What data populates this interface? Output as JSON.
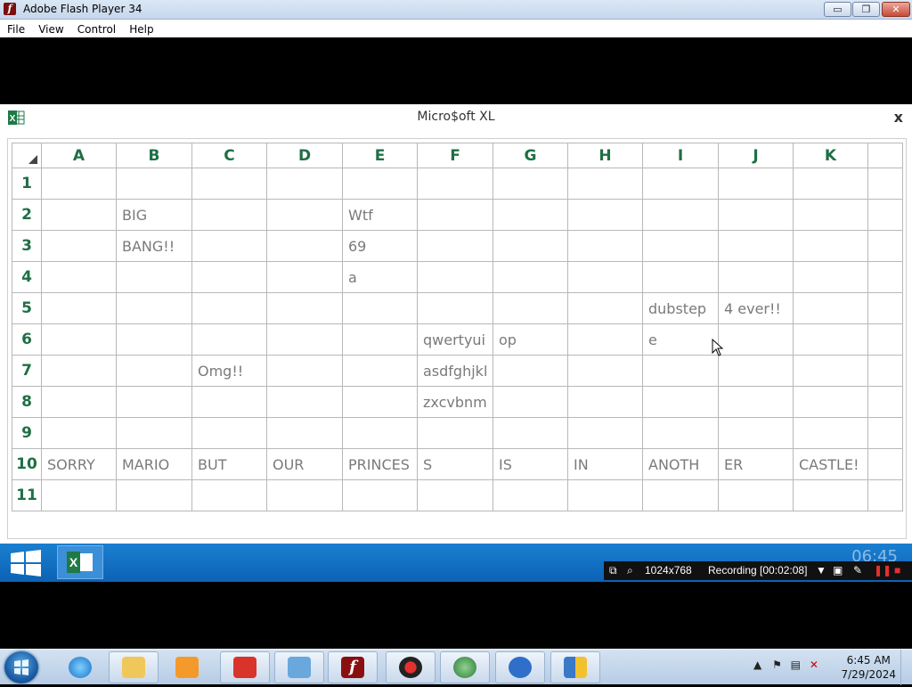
{
  "window": {
    "title": "Adobe Flash Player 34",
    "min": "▭",
    "max": "❐",
    "close": "✕"
  },
  "menu": [
    "File",
    "View",
    "Control",
    "Help"
  ],
  "xl": {
    "title": "Micro$oft XL",
    "close": "x",
    "columns": [
      "A",
      "B",
      "C",
      "D",
      "E",
      "F",
      "G",
      "H",
      "I",
      "J",
      "K"
    ],
    "rows": [
      {
        "n": "1",
        "cells": [
          "",
          "",
          "",
          "",
          "",
          "",
          "",
          "",
          "",
          "",
          ""
        ]
      },
      {
        "n": "2",
        "cells": [
          "",
          "BIG",
          "",
          "",
          "Wtf",
          "",
          "",
          "",
          "",
          "",
          ""
        ]
      },
      {
        "n": "3",
        "cells": [
          "",
          "BANG!!",
          "",
          "",
          "69",
          "",
          "",
          "",
          "",
          "",
          ""
        ]
      },
      {
        "n": "4",
        "cells": [
          "",
          "",
          "",
          "",
          "a",
          "",
          "",
          "",
          "",
          "",
          ""
        ]
      },
      {
        "n": "5",
        "cells": [
          "",
          "",
          "",
          "",
          "",
          "",
          "",
          "",
          "dubstep",
          "4 ever!!",
          ""
        ]
      },
      {
        "n": "6",
        "cells": [
          "",
          "",
          "",
          "",
          "",
          "qwertyui",
          "op",
          "",
          "e",
          "",
          ""
        ]
      },
      {
        "n": "7",
        "cells": [
          "",
          "",
          "Omg!!",
          "",
          "",
          "asdfghjkl",
          "",
          "",
          "",
          "",
          ""
        ]
      },
      {
        "n": "8",
        "cells": [
          "",
          "",
          "",
          "",
          "",
          "zxcvbnm",
          "",
          "",
          "",
          "",
          ""
        ]
      },
      {
        "n": "9",
        "cells": [
          "",
          "",
          "",
          "",
          "",
          "",
          "",
          "",
          "",
          "",
          ""
        ]
      },
      {
        "n": "10",
        "cells": [
          "SORRY",
          "MARIO",
          "BUT",
          "OUR",
          "PRINCES",
          "S",
          "IS",
          "IN",
          "ANOTH",
          "ER",
          "CASTLE!"
        ]
      },
      {
        "n": "11",
        "cells": [
          "",
          "",
          "",
          "",
          "",
          "",
          "",
          "",
          "",
          "",
          ""
        ]
      }
    ]
  },
  "inner_taskbar": {
    "clock": "06:45"
  },
  "recorder": {
    "resolution": "1024x768",
    "status": "Recording [00:02:08]"
  },
  "taskbar": {
    "items": [
      "internet-explorer",
      "file-explorer",
      "media-player",
      "app-red",
      "control-panel",
      "flash-player",
      "app-record",
      "app-globe",
      "app-blue",
      "app-shield"
    ],
    "time": "6:45 AM",
    "date": "7/29/2024"
  }
}
